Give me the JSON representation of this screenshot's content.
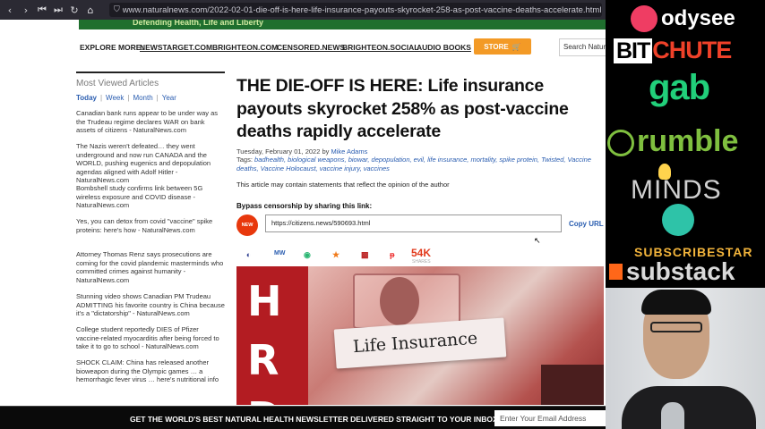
{
  "browser": {
    "url": "www.naturalnews.com/2022-02-01-die-off-is-here-life-insurance-payouts-skyrocket-258-as-post-vaccine-deaths-accelerate.html",
    "nav": [
      "back-icon",
      "forward-icon",
      "skip-back-icon",
      "skip-forward-icon",
      "reload-icon",
      "home-icon"
    ]
  },
  "banner": {
    "text": "Defending Health, Life and Liberty"
  },
  "explore": {
    "label": "EXPLORE MORE:",
    "links": [
      "NEWSTARGET.COM",
      "BRIGHTEON.COM",
      "CENSORED.NEWS",
      "BRIGHTEON.SOCIAL",
      "AUDIO BOOKS"
    ],
    "store_label": "STORE",
    "search_placeholder": "Search Natural"
  },
  "sidebar": {
    "heading": "Most Viewed Articles",
    "tabs": [
      "Today",
      "Week",
      "Month",
      "Year"
    ],
    "items": [
      "Canadian bank runs appear to be under way as the Trudeau regime declares WAR on bank assets of citizens - NaturalNews.com",
      "The Nazis weren't defeated… they went underground and now run CANADA and the WORLD, pushing eugenics and depopulation agendas aligned with Adolf Hitler - NaturalNews.com",
      "Bombshell study confirms link between 5G wireless exposure and COVID disease - NaturalNews.com",
      "Yes, you can detox from covid \"vaccine\" spike proteins: here's how - NaturalNews.com",
      "Attorney Thomas Renz says prosecutions are coming for the covid plandemic masterminds who committed crimes against humanity - NaturalNews.com",
      "Stunning video shows Canadian PM Trudeau ADMITTING his favorite country is China because it's a \"dictatorship\" - NaturalNews.com",
      "College student reportedly DIES of Pfizer vaccine-related myocarditis after being forced to take it to go to school - NaturalNews.com",
      "SHOCK CLAIM: China has released another bioweapon during the Olympic games … a hemorrhagic fever virus … here's nutritional info"
    ]
  },
  "article": {
    "title": "THE DIE-OFF IS HERE: Life insurance payouts skyrocket 258% as post-vaccine deaths rapidly accelerate",
    "date": "Tuesday, February 01, 2022 by",
    "author": "Mike Adams",
    "tags_label": "Tags:",
    "tags": "badhealth, biological weapons, biowar, depopulation, evil, life insurance, mortality, spike protein, Twisted, Vaccine deaths, Vaccine Holocaust, vaccine injury, vaccines",
    "disclaimer": "This article may contain statements that reflect the opinion of the author",
    "bypass_label": "Bypass censorship by sharing this link:",
    "new_badge": "NEW",
    "share_url": "https://citizens.news/590693.html",
    "copy_label": "Copy URL",
    "share_count": "54K",
    "share_sub": "SHARES",
    "hero_letters": [
      "H",
      "R",
      "D"
    ],
    "hero_text": "Life Insurance"
  },
  "footer": {
    "message": "GET THE WORLD'S BEST NATURAL HEALTH NEWSLETTER DELIVERED STRAIGHT TO YOUR INBOX.",
    "email_placeholder": "Enter Your Email Address"
  },
  "promo": {
    "odysee": "odysee",
    "bit": "BIT",
    "chute": "CHUTE",
    "gab": "gab",
    "rumble": "rumble",
    "minds": "MINDS",
    "subscribestar": "SUBSCRIBESTAR",
    "substack": "substack"
  }
}
